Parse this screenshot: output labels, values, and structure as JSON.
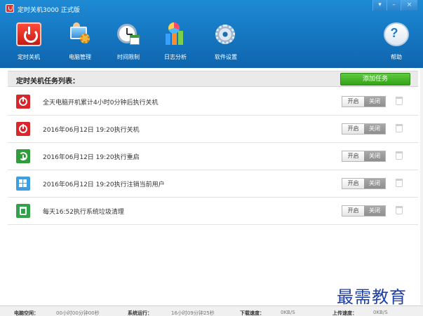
{
  "window": {
    "title": "定时关机3000 正式版",
    "controls": [
      "▾",
      "–",
      "×"
    ]
  },
  "toolbar": {
    "items": [
      {
        "label": "定时关机",
        "icon": "power-icon"
      },
      {
        "label": "电脑管理",
        "icon": "computer-management-icon"
      },
      {
        "label": "时间限制",
        "icon": "clock-icon"
      },
      {
        "label": "日志分析",
        "icon": "chart-icon"
      },
      {
        "label": "软件设置",
        "icon": "gear-icon"
      },
      {
        "label": "帮助",
        "icon": "help-icon"
      }
    ],
    "help_glyph": "?"
  },
  "list": {
    "title": "定时关机任务列表：",
    "add_button": "添加任务"
  },
  "tasks": [
    {
      "text": "全天电脑开机累计4小时0分钟后执行关机",
      "icon": "shutdown-icon",
      "color": "#d8262a",
      "on_label": "开启",
      "off_label": "关闭"
    },
    {
      "text": "2016年06月12日 19:20执行关机",
      "icon": "shutdown-icon",
      "color": "#d8262a",
      "on_label": "开启",
      "off_label": "关闭"
    },
    {
      "text": "2016年06月12日 19:20执行重启",
      "icon": "restart-icon",
      "color": "#2f9d3c",
      "on_label": "开启",
      "off_label": "关闭"
    },
    {
      "text": "2016年06月12日 19:20执行注销当前用户",
      "icon": "windows-icon",
      "color": "#3d9ee2",
      "on_label": "开启",
      "off_label": "关闭"
    },
    {
      "text": "每天16:52执行系统垃圾清理",
      "icon": "recycle-bin-icon",
      "color": "#2fa24a",
      "on_label": "开启",
      "off_label": "关闭"
    }
  ],
  "status": {
    "uptime_label": "电脑空闲：",
    "uptime_value": "00小时00分钟00秒",
    "runtime_label": "系统运行：",
    "runtime_value": "16小时09分钟25秒",
    "download_label": "下载速度：",
    "download_value": "0KB/S",
    "upload_label": "上传速度：",
    "upload_value": "0KB/S"
  },
  "watermark": "最需教育",
  "colors": {
    "header": "#1679c4",
    "add_button": "#33a318",
    "off_toggle": "#9a9a9a"
  }
}
